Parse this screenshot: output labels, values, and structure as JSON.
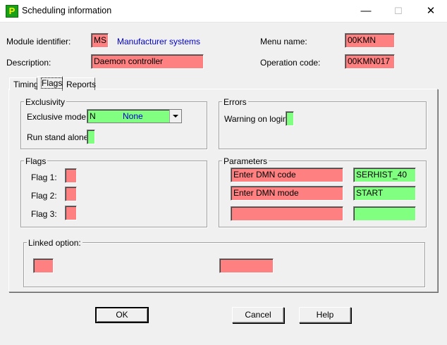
{
  "window": {
    "title": "Scheduling information",
    "icon_glyph": "P",
    "minimize": "—",
    "maximize": "☐",
    "close": "✕"
  },
  "header": {
    "module_identifier_label": "Module identifier:",
    "module_identifier_value": "MS",
    "module_name": "Manufacturer systems",
    "menu_name_label": "Menu name:",
    "menu_name_value": "00KMN",
    "description_label": "Description:",
    "description_value": "Daemon controller",
    "operation_code_label": "Operation code:",
    "operation_code_value": "00KMN017"
  },
  "tabs": [
    {
      "label": "Timing"
    },
    {
      "label": "Flags"
    },
    {
      "label": "Reports"
    }
  ],
  "exclusivity": {
    "title": "Exclusivity",
    "exclusive_mode_label": "Exclusive mode:",
    "exclusive_mode_code": "N",
    "exclusive_mode_text": "None",
    "run_stand_alone_label": "Run stand alone:",
    "run_stand_alone_value": ""
  },
  "errors": {
    "title": "Errors",
    "warning_on_login_label": "Warning on login:",
    "warning_on_login_value": ""
  },
  "flags": {
    "title": "Flags",
    "items": [
      {
        "label": "Flag 1:",
        "value": ""
      },
      {
        "label": "Flag 2:",
        "value": ""
      },
      {
        "label": "Flag 3:",
        "value": ""
      }
    ]
  },
  "parameters": {
    "title": "Parameters",
    "rows": [
      {
        "name": "Enter DMN code",
        "value": "SERHIST_40"
      },
      {
        "name": "Enter DMN mode",
        "value": "START"
      },
      {
        "name": "",
        "value": ""
      }
    ]
  },
  "linked_option": {
    "title": "Linked option:",
    "code": "",
    "name": ""
  },
  "buttons": {
    "ok": "OK",
    "cancel": "Cancel",
    "help": "Help"
  },
  "colors": {
    "required_field": "#ff8080",
    "optional_field": "#80ff80",
    "link_text": "#0000c8"
  },
  "icons": [
    "app-p-icon",
    "minimize-icon",
    "maximize-icon",
    "close-icon",
    "dropdown-arrow-icon"
  ]
}
